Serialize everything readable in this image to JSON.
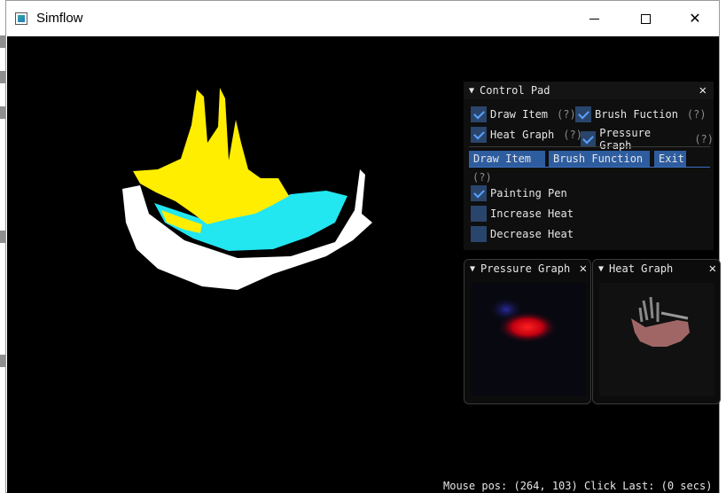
{
  "window": {
    "title": "Simflow",
    "icon": "app-icon"
  },
  "controls": {
    "minimize_icon": "minimize-icon",
    "maximize_icon": "maximize-icon",
    "close_glyph": "✕"
  },
  "control_pad": {
    "title": "Control Pad",
    "collapse_glyph": "▼",
    "close_glyph": "✕",
    "help": "(?)",
    "checkboxes": [
      {
        "label": "Draw Item",
        "checked": true
      },
      {
        "label": "Brush Fuction",
        "checked": true
      },
      {
        "label": "Heat Graph",
        "checked": true
      },
      {
        "label": "Pressure Graph",
        "checked": true
      }
    ],
    "tabs": [
      "Draw Item",
      "Brush Function",
      "Exit"
    ],
    "active_tab": "Brush Function",
    "brush_options": [
      {
        "label": "Painting Pen",
        "checked": true
      },
      {
        "label": "Increase Heat",
        "checked": false
      },
      {
        "label": "Decrease Heat",
        "checked": false
      }
    ]
  },
  "pressure_graph": {
    "title": "Pressure Graph",
    "collapse_glyph": "▼",
    "close_glyph": "✕"
  },
  "heat_graph": {
    "title": "Heat Graph",
    "collapse_glyph": "▼",
    "close_glyph": "✕"
  },
  "status": {
    "text": "Mouse pos: (264, 103) Click Last: (0 secs)"
  },
  "colors": {
    "fluid_yellow": "#ffee00",
    "fluid_cyan": "#22e6f0",
    "container_white": "#ffffff",
    "checkbox_bg": "#29456b",
    "check_mark": "#5aa0ff",
    "tab_bg": "#2e5d9f"
  }
}
